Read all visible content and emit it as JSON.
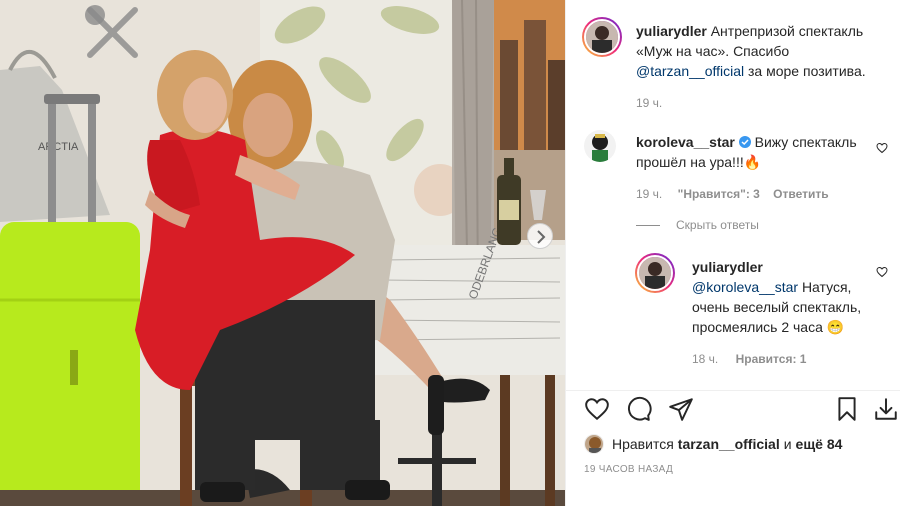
{
  "post": {
    "author": "yuliarydler",
    "caption_part1": "Антрепризой спектакль «Муж на час». Спасибо",
    "caption_mention": "@tarzan__official",
    "caption_part2": "за море позитива.",
    "caption_time": "19 ч."
  },
  "comments": [
    {
      "username": "koroleva__star",
      "text": "Вижу спектакль прошёл на ура!!!🔥",
      "time": "19 ч.",
      "likes": "\"Нравится\": 3",
      "reply_label": "Ответить"
    }
  ],
  "hide_replies_label": "Скрыть ответы",
  "reply": {
    "username": "yuliarydler",
    "mention": "@koroleva__star",
    "text": "Натуся, очень веселый спектакль, просмеялись 2 часа 😁",
    "time": "18 ч.",
    "likes": "Нравится: 1"
  },
  "likes_line": {
    "prefix": "Нравится",
    "user": "tarzan__official",
    "middle": "и",
    "others": "ещё 84"
  },
  "date": "19 ЧАСОВ НАЗАД",
  "photo_text": {
    "bag_label": "ARCTIA",
    "newspaper_label": "ODEBRLANG"
  },
  "icons": {
    "like": "heart-icon",
    "comment": "comment-icon",
    "share": "share-icon",
    "save": "bookmark-icon",
    "download": "download-icon",
    "next": "chevron-right-icon",
    "verified": "verified-badge-icon"
  },
  "colors": {
    "link": "#00376b",
    "muted": "#8e8e8e",
    "verified": "#3897f0",
    "dress": "#d81d26",
    "suitcase": "#b7ea1d"
  }
}
